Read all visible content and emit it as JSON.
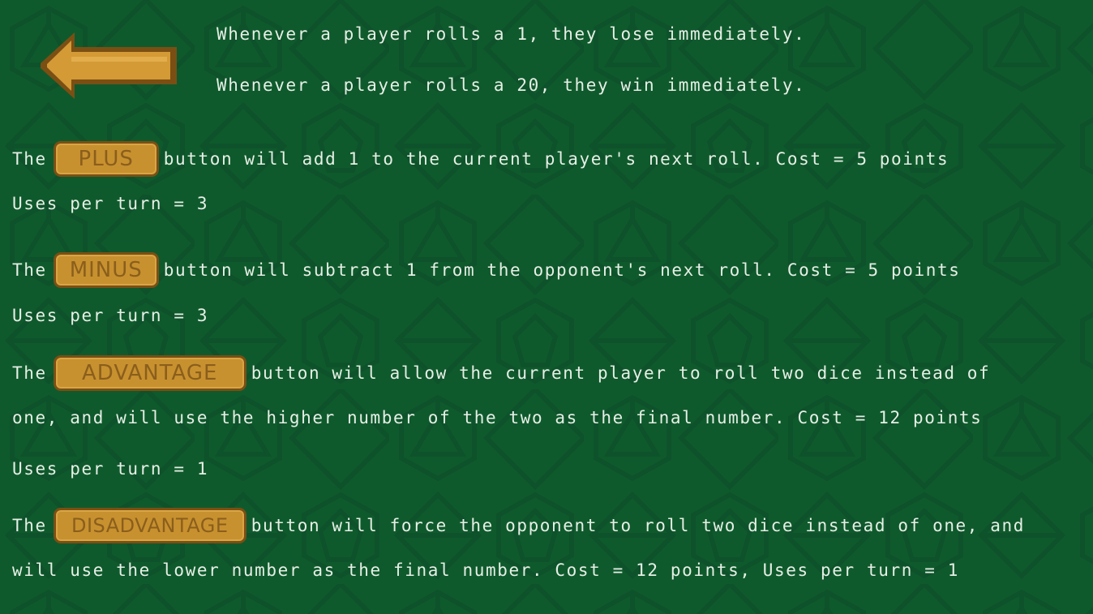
{
  "colors": {
    "background": "#0f5a2c",
    "button": "#c8912f",
    "button_border": "#7a4f14",
    "button_text": "#8a5e1c",
    "text": "#e6efe6"
  },
  "back_button": {
    "icon": "left-arrow-icon"
  },
  "rules": {
    "roll_one": "Whenever a player rolls a 1, they lose immediately.",
    "roll_twenty": "Whenever a player rolls a 20, they win immediately."
  },
  "plus": {
    "prefix": "The",
    "button_label": "PLUS",
    "desc": "button will add 1 to the current player's next roll. Cost = 5 points",
    "uses": "Uses per turn = 3"
  },
  "minus": {
    "prefix": "The",
    "button_label": "MINUS",
    "desc": "button will subtract 1 from the opponent's next roll. Cost = 5 points",
    "uses": "Uses per turn = 3"
  },
  "advantage": {
    "prefix": "The",
    "button_label": "ADVANTAGE",
    "desc_line1": "button will allow the current player to roll two dice instead of",
    "desc_line2": "one, and will use the higher number of the two as the final number. Cost = 12 points",
    "uses": "Uses per turn = 1"
  },
  "disadvantage": {
    "prefix": "The",
    "button_label": "DISADVANTAGE",
    "desc_line1": "button will force the opponent to roll two dice instead of one, and",
    "desc_line2": "will use the lower number as the final number. Cost = 12 points, Uses per turn = 1"
  }
}
